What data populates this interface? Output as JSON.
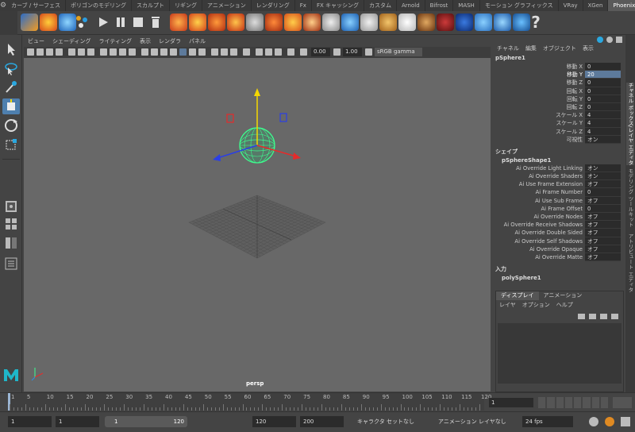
{
  "shelf": {
    "tabs": [
      "カーブ / サーフェス",
      "ポリゴンのモデリング",
      "スカルプト",
      "リギング",
      "アニメーション",
      "レンダリング",
      "Fx",
      "FX キャッシング",
      "カスタム",
      "Arnold",
      "Bifrost",
      "MASH",
      "モーション グラフィックス",
      "VRay",
      "XGen",
      "PhoenixFD"
    ],
    "active_tab": "PhoenixFD",
    "help_symbol": "?"
  },
  "viewport": {
    "menu": [
      "ビュー",
      "シェーディング",
      "ライティング",
      "表示",
      "レンダラ",
      "パネル"
    ],
    "near_value": "0.00",
    "far_value": "1.00",
    "color_space": "sRGB gamma",
    "camera_label": "persp"
  },
  "channel_box": {
    "menu": [
      "チャネル",
      "編集",
      "オブジェクト",
      "表示"
    ],
    "object_name": "pSphere1",
    "transform": [
      {
        "label": "移動 X",
        "value": "0"
      },
      {
        "label": "移動 Y",
        "value": "20",
        "selected": true
      },
      {
        "label": "移動 Z",
        "value": "0"
      },
      {
        "label": "回転 X",
        "value": "0"
      },
      {
        "label": "回転 Y",
        "value": "0"
      },
      {
        "label": "回転 Z",
        "value": "0"
      },
      {
        "label": "スケール X",
        "value": "4"
      },
      {
        "label": "スケール Y",
        "value": "4"
      },
      {
        "label": "スケール Z",
        "value": "4"
      },
      {
        "label": "可視性",
        "value": "オン"
      }
    ],
    "shape_header": "シェイプ",
    "shape_name": "pSphereShape1",
    "shape_attrs": [
      {
        "label": "Ai Override Light Linking",
        "value": "オン"
      },
      {
        "label": "Ai Override Shaders",
        "value": "オン"
      },
      {
        "label": "Ai Use Frame Extension",
        "value": "オフ"
      },
      {
        "label": "Ai Frame Number",
        "value": "0"
      },
      {
        "label": "Ai Use Sub Frame",
        "value": "オフ"
      },
      {
        "label": "Ai Frame Offset",
        "value": "0"
      },
      {
        "label": "Ai Override Nodes",
        "value": "オフ"
      },
      {
        "label": "Ai Override Receive Shadows",
        "value": "オフ"
      },
      {
        "label": "Ai Override Double Sided",
        "value": "オフ"
      },
      {
        "label": "Ai Override Self Shadows",
        "value": "オフ"
      },
      {
        "label": "Ai Override Opaque",
        "value": "オフ"
      },
      {
        "label": "Ai Override Matte",
        "value": "オフ"
      }
    ],
    "input_header": "入力",
    "input_name": "polySphere1"
  },
  "side_tabs": [
    "チャネル ボックス/レイヤ エディタ",
    "モデリング ツールキット",
    "アトリビュート エディタ"
  ],
  "layer_editor": {
    "tabs": [
      "ディスプレイ",
      "アニメーション"
    ],
    "menu": [
      "レイヤ",
      "オプション",
      "ヘルプ"
    ]
  },
  "timeline": {
    "ticks": [
      "1",
      "5",
      "10",
      "15",
      "20",
      "25",
      "30",
      "35",
      "40",
      "45",
      "50",
      "55",
      "60",
      "65",
      "70",
      "75",
      "80",
      "85",
      "90",
      "95",
      "100",
      "105",
      "110",
      "115",
      "120"
    ],
    "current_frame": "1"
  },
  "range": {
    "start": "1",
    "anim_start": "1",
    "slider_start": "1",
    "slider_end": "120",
    "range_end": "120",
    "anim_end": "200",
    "character_set": "キャラクタ セットなし",
    "anim_layer": "アニメーション レイヤなし",
    "fps": "24 fps"
  },
  "colors": {
    "accent_blue": "#5d7a9b",
    "sphere": "#3dff8f",
    "axis_y": "#f5d800",
    "axis_x": "#e52b2b",
    "axis_z": "#2b3fe5"
  }
}
